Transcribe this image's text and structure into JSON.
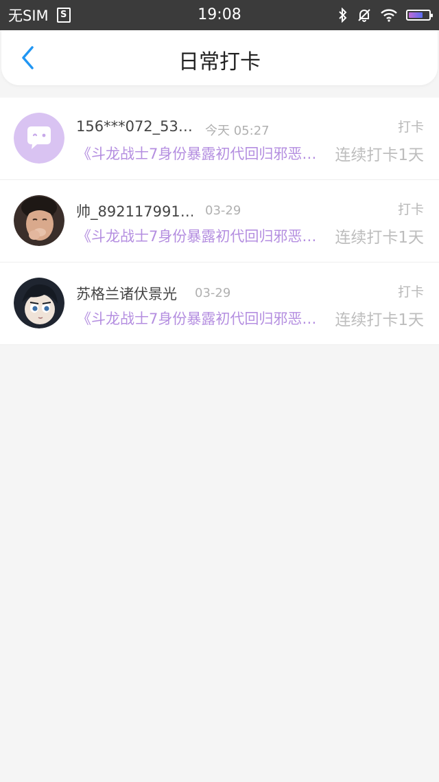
{
  "status_bar": {
    "carrier": "无SIM",
    "time": "19:08"
  },
  "header": {
    "title": "日常打卡"
  },
  "items": [
    {
      "user": "156***072_53…",
      "time": "今天 05:27",
      "tag": "打卡",
      "book": "《斗龙战士7身份暴露初代回归邪恶…",
      "streak": "连续打卡1天",
      "avatar": "chat-bubble-avatar"
    },
    {
      "user": "帅_892117991…",
      "time": "03-29",
      "tag": "打卡",
      "book": "《斗龙战士7身份暴露初代回归邪恶…",
      "streak": "连续打卡1天",
      "avatar": "photo-avatar"
    },
    {
      "user": "苏格兰诸伏景光",
      "time": "03-29",
      "tag": "打卡",
      "book": "《斗龙战士7身份暴露初代回归邪恶…",
      "streak": "连续打卡1天",
      "avatar": "anime-avatar"
    }
  ],
  "colors": {
    "accent": "#2196f3",
    "book_title": "#b48ee0",
    "status_bar": "#3b3b3b"
  }
}
